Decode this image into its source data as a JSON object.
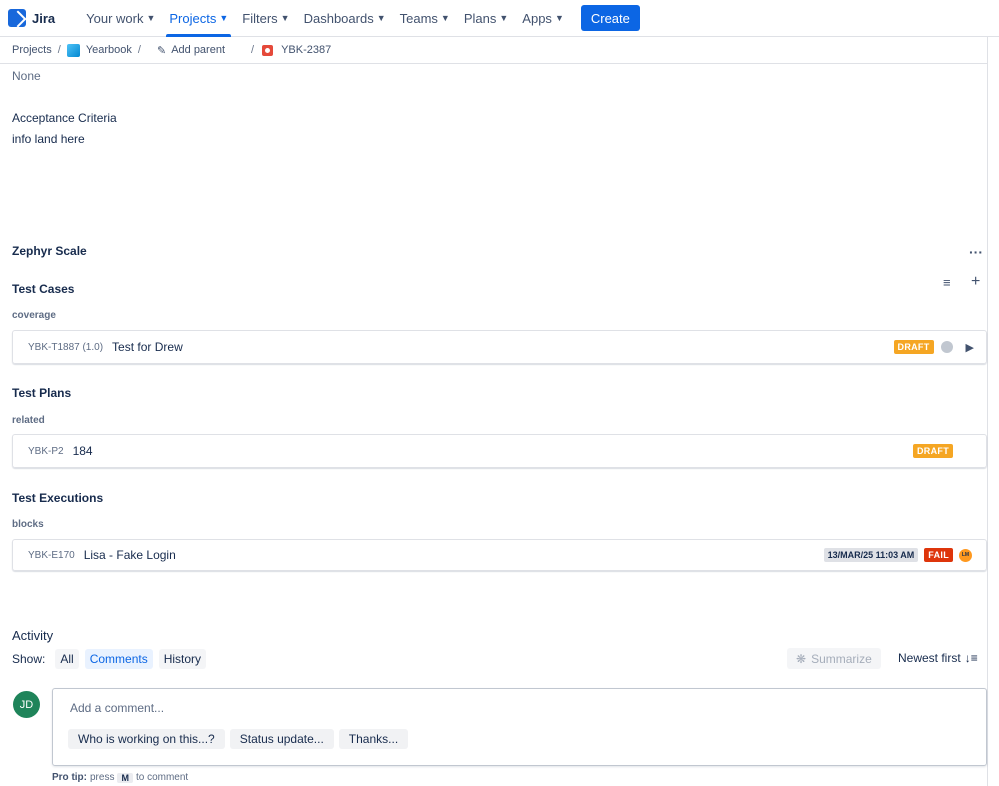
{
  "nav": {
    "logo_text": "Jira",
    "items": [
      {
        "label": "Your work",
        "active": false
      },
      {
        "label": "Projects",
        "active": true
      },
      {
        "label": "Filters",
        "active": false
      },
      {
        "label": "Dashboards",
        "active": false
      },
      {
        "label": "Teams",
        "active": false
      },
      {
        "label": "Plans",
        "active": false
      },
      {
        "label": "Apps",
        "active": false
      }
    ],
    "create_label": "Create",
    "accent_color": "#0c66e4"
  },
  "breadcrumb": {
    "projects": "Projects",
    "project": "Yearbook",
    "add_parent": "Add parent",
    "issue_key": "YBK-2387"
  },
  "fields": {
    "none_value": "None",
    "acceptance_label": "Acceptance Criteria",
    "acceptance_value": "info land here"
  },
  "zephyr": {
    "title": "Zephyr Scale",
    "test_cases": {
      "title": "Test Cases",
      "relation": "coverage",
      "item": {
        "key": "YBK-T1887 (1.0)",
        "name": "Test for Drew",
        "status": "DRAFT"
      }
    },
    "test_plans": {
      "title": "Test Plans",
      "relation": "related",
      "item": {
        "key": "YBK-P2",
        "name": "184",
        "status": "DRAFT"
      }
    },
    "test_executions": {
      "title": "Test Executions",
      "relation": "blocks",
      "item": {
        "key": "YBK-E170",
        "name": "Lisa - Fake Login",
        "date": "13/MAR/25 11:03 AM",
        "status": "FAIL",
        "assignee_initials": "LM"
      }
    }
  },
  "activity": {
    "title": "Activity",
    "show_label": "Show:",
    "filters": [
      {
        "label": "All",
        "selected": false
      },
      {
        "label": "Comments",
        "selected": true
      },
      {
        "label": "History",
        "selected": false
      }
    ],
    "summarize_label": "Summarize",
    "sort_label": "Newest first",
    "user_initials": "JD",
    "comment_placeholder": "Add a comment...",
    "suggestions": [
      "Who is working on this...?",
      "Status update...",
      "Thanks..."
    ],
    "protip_label": "Pro tip:",
    "protip_press": "press",
    "protip_key": "M",
    "protip_suffix": "to comment"
  }
}
